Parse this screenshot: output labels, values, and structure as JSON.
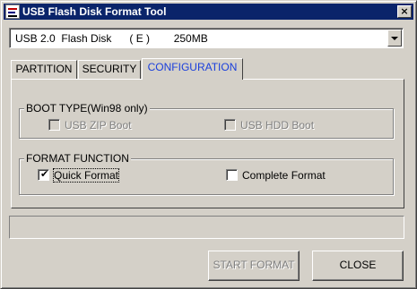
{
  "window": {
    "title": "USB Flash Disk Format Tool",
    "close_glyph": "×",
    "icon": "app-icon",
    "title_bar_color": "#0a246a"
  },
  "device": {
    "selected": "USB 2.0  Flash Disk      ( E )        250MB"
  },
  "tabs": [
    {
      "label": "PARTITION",
      "active": false
    },
    {
      "label": "SECURITY",
      "active": false
    },
    {
      "label": "CONFIGURATION",
      "active": true
    }
  ],
  "boot_type": {
    "label": "BOOT TYPE(Win98 only)",
    "options": [
      {
        "label": "USB ZIP Boot",
        "checked": false,
        "enabled": false
      },
      {
        "label": "USB HDD Boot",
        "checked": false,
        "enabled": false
      }
    ]
  },
  "format_function": {
    "label": "FORMAT FUNCTION",
    "options": [
      {
        "label": "Quick Format",
        "checked": true,
        "enabled": true,
        "mark": "✔"
      },
      {
        "label": "Complete Format",
        "checked": false,
        "enabled": true
      }
    ]
  },
  "status": {
    "text": ""
  },
  "buttons": {
    "start_format": "START FORMAT",
    "close": "CLOSE"
  },
  "colors": {
    "active_tab_text": "#1a3fdc",
    "disabled_text": "#808080",
    "face": "#d4d0c8"
  }
}
